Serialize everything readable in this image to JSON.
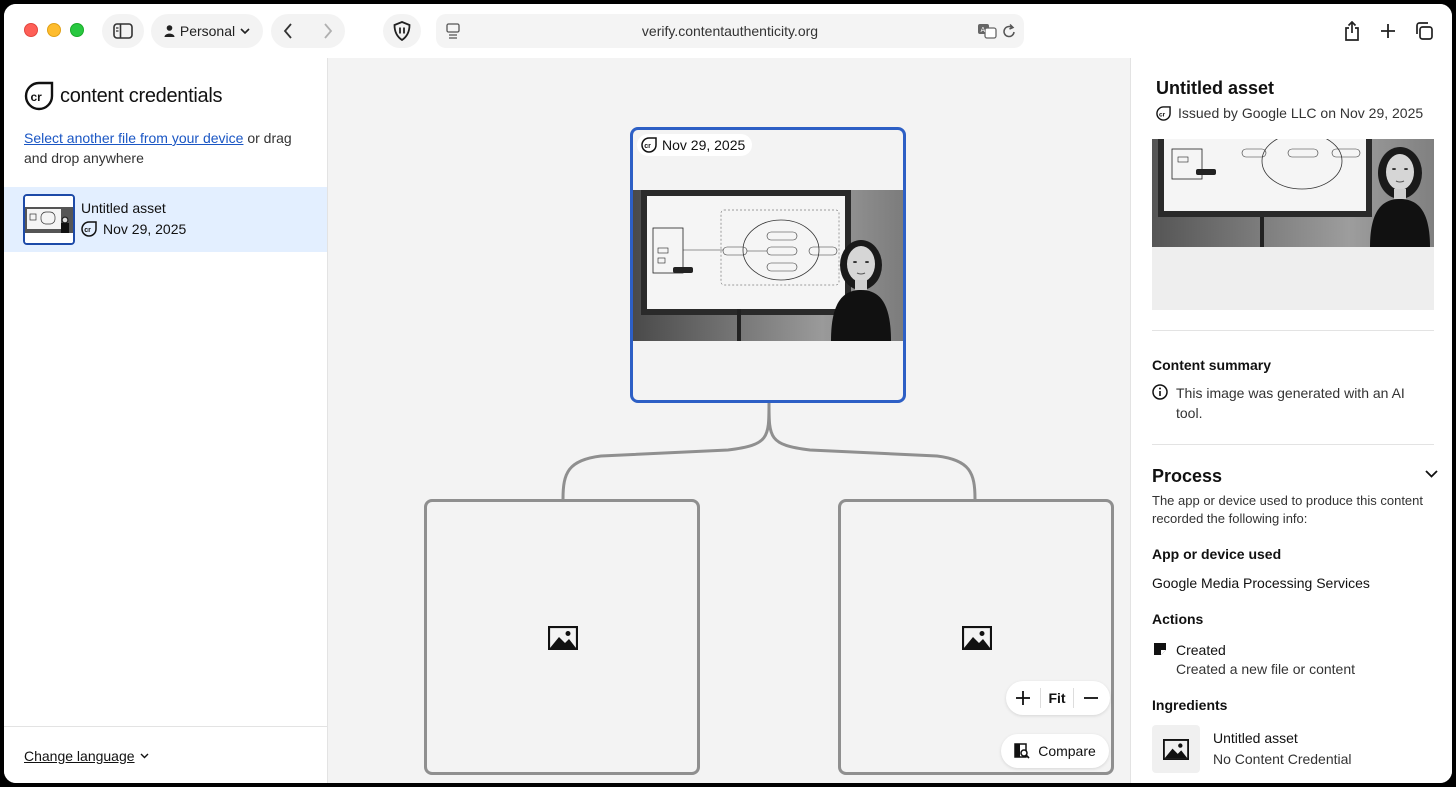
{
  "browser": {
    "profile_label": "Personal",
    "url": "verify.contentauthenticity.org"
  },
  "sidebar": {
    "logo_text": "content credentials",
    "upload_link": "Select another file from your device",
    "upload_rest": " or drag and drop anywhere",
    "assets": [
      {
        "title": "Untitled asset",
        "date": "Nov 29, 2025"
      }
    ],
    "change_language": "Change language"
  },
  "canvas": {
    "main_node_date": "Nov 29, 2025",
    "zoom_fit_label": "Fit",
    "compare_label": "Compare"
  },
  "panel": {
    "title": "Untitled asset",
    "issued": "Issued by Google LLC on Nov 29, 2025",
    "content_summary_heading": "Content summary",
    "content_summary_text": "This image was generated with an AI tool.",
    "process_heading": "Process",
    "process_intro": "The app or device used to produce this content recorded the following info:",
    "app_heading": "App or device used",
    "app_value": "Google Media Processing Services",
    "actions_heading": "Actions",
    "action_title": "Created",
    "action_desc": "Created a new file or content",
    "ingredients_heading": "Ingredients",
    "ingredient_title": "Untitled asset",
    "ingredient_desc": "No Content Credential"
  },
  "colors": {
    "accent": "#2d5fc5",
    "selected_row": "#e3efff",
    "link": "#1a56c4",
    "canvas_bg": "#f3f3f3"
  }
}
